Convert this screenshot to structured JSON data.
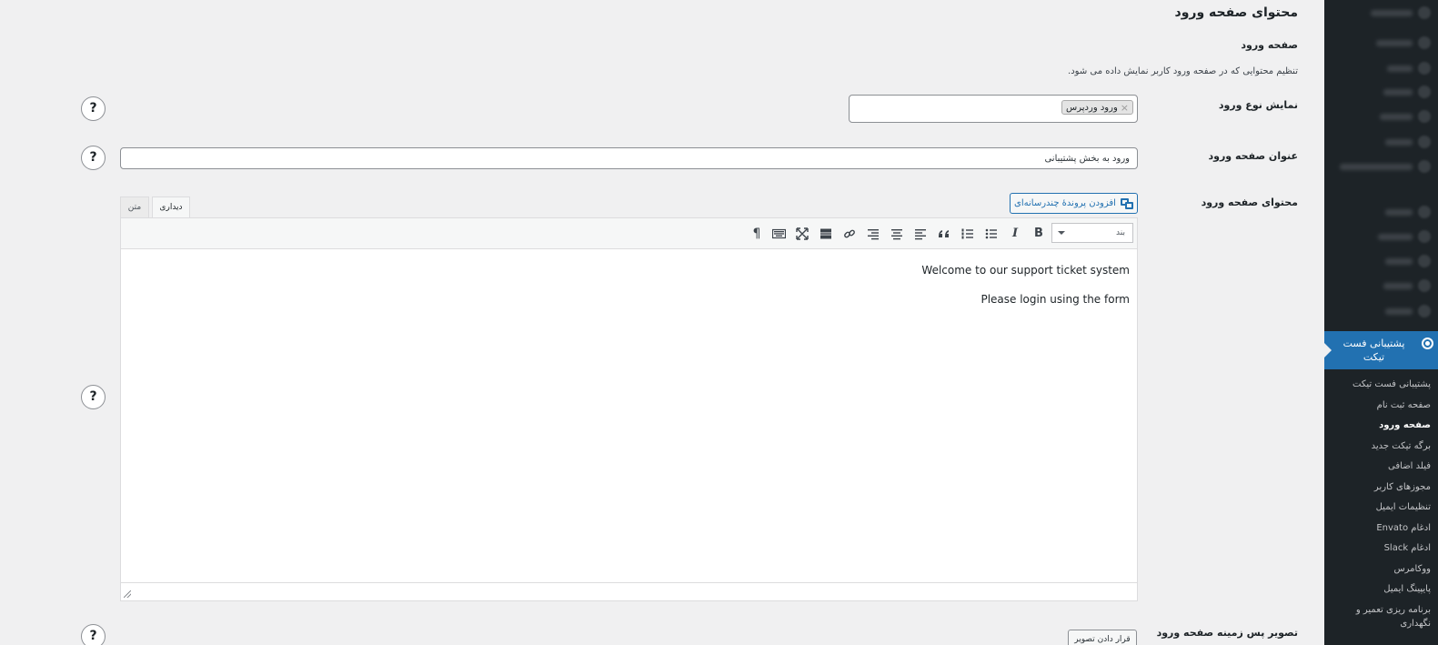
{
  "page": {
    "title": "محتوای صفحه ورود",
    "section_title": "صفحه ورود",
    "section_description": "تنظیم محتوایی که در صفحه ورود کاربر نمایش داده می شود."
  },
  "fields": {
    "login_type": {
      "label": "نمایش نوع ورود",
      "selected_chip": "ورود وردپرس",
      "chip_remove": "×"
    },
    "login_title": {
      "label": "عنوان صفحه ورود",
      "value": "ورود به بخش پشتیبانی"
    },
    "login_content": {
      "label": "محتوای صفحه ورود",
      "add_media_label": "افزودن پروندهٔ چندرسانه‌ای",
      "tab_visual": "دیداری",
      "tab_text": "متن",
      "format_select_value": "بند",
      "paragraphs": [
        "Welcome to our support ticket system",
        "Please login using the form"
      ]
    },
    "background_image": {
      "label": "تصویر پس زمینه صفحه ورود",
      "upload_label": "قرار دادن تصویر"
    }
  },
  "help_button": "?",
  "toolbar": {
    "bold": "B",
    "italic": "I",
    "pilcrow": "¶"
  },
  "sidebar": {
    "current_menu": "پشتیبانی فست تیکت",
    "submenu": [
      "پشتیبانی فست تیکت",
      "صفحه ثبت نام",
      "صفحه ورود",
      "برگه تیکت جدید",
      "فیلد اضافی",
      "مجوزهای کاربر",
      "تنظیمات ایمیل",
      "ادغام Envato",
      "ادغام Slack",
      "ووکامرس",
      "پایپینگ ایمیل",
      "برنامه ریزی تعمیر و نگهداری"
    ],
    "active_index": 2
  },
  "colors": {
    "accent": "#2271b1",
    "sidebar_bg": "#1d2327",
    "page_bg": "#f0f0f1"
  }
}
